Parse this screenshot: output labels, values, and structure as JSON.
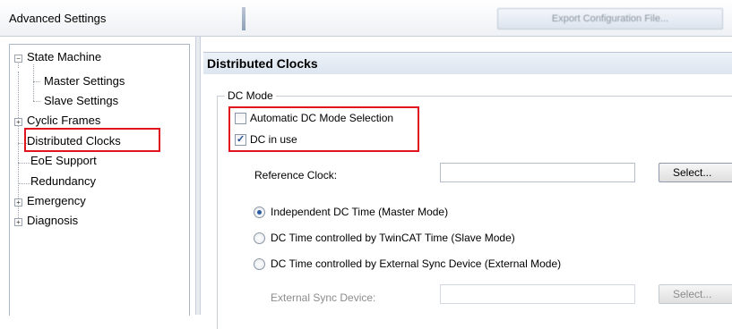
{
  "window": {
    "title": "Advanced Settings",
    "export_button_label": "Export Configuration File..."
  },
  "tree": {
    "items": [
      {
        "label": "State Machine",
        "expander": "minus"
      },
      {
        "label": "Master Settings"
      },
      {
        "label": "Slave Settings"
      },
      {
        "label": "Cyclic Frames",
        "expander": "plus"
      },
      {
        "label": "Distributed Clocks",
        "selected": true
      },
      {
        "label": "EoE Support"
      },
      {
        "label": "Redundancy"
      },
      {
        "label": "Emergency",
        "expander": "plus"
      },
      {
        "label": "Diagnosis",
        "expander": "plus"
      }
    ]
  },
  "panel": {
    "title": "Distributed Clocks",
    "group_label": "DC Mode",
    "automatic_dc_label": "Automatic DC Mode Selection",
    "automatic_dc_checked": false,
    "dc_in_use_label": "DC in use",
    "dc_in_use_checked": true,
    "reference_clock_label": "Reference Clock:",
    "reference_clock_value": "",
    "select_button_label": "Select...",
    "radio_options": [
      {
        "label": "Independent DC Time (Master Mode)",
        "selected": true
      },
      {
        "label": "DC Time controlled by TwinCAT Time (Slave Mode)",
        "selected": false
      },
      {
        "label": "DC Time controlled by External Sync Device (External Mode)",
        "selected": false
      }
    ],
    "external_sync_label": "External Sync Device:",
    "external_sync_value": "",
    "external_select_button_label": "Select..."
  },
  "colors": {
    "highlight": "#e0141c",
    "header_bg": "#dce5f0",
    "radio_dot": "#2a5aa0"
  },
  "icons": {
    "expander_minus": "minus-box-icon",
    "expander_plus": "plus-box-icon",
    "check": "checkmark-icon"
  }
}
